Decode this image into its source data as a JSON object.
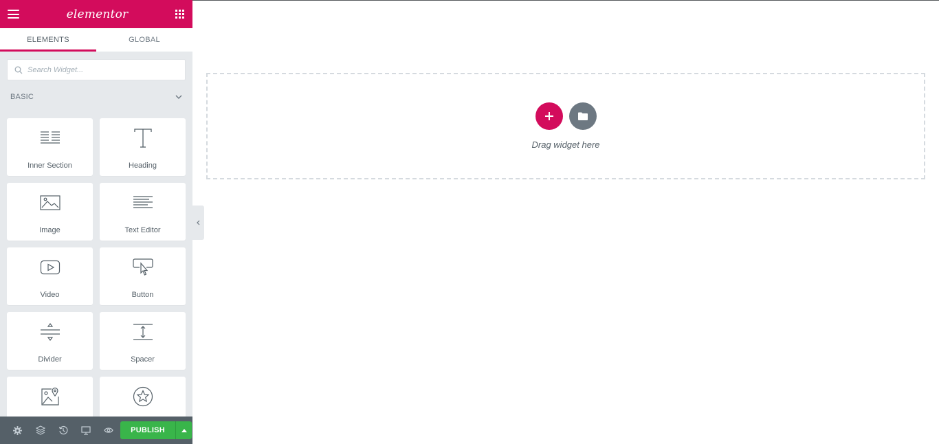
{
  "app": {
    "logo": "elementor",
    "brand_color": "#d30c5c"
  },
  "tabs": [
    {
      "label": "ELEMENTS",
      "active": true
    },
    {
      "label": "GLOBAL",
      "active": false
    }
  ],
  "search": {
    "placeholder": "Search Widget..."
  },
  "category": {
    "label": "BASIC",
    "expanded": true
  },
  "widgets": [
    {
      "label": "Inner Section",
      "icon": "columns-icon"
    },
    {
      "label": "Heading",
      "icon": "heading-icon"
    },
    {
      "label": "Image",
      "icon": "image-icon"
    },
    {
      "label": "Text Editor",
      "icon": "text-editor-icon"
    },
    {
      "label": "Video",
      "icon": "video-icon"
    },
    {
      "label": "Button",
      "icon": "button-icon"
    },
    {
      "label": "Divider",
      "icon": "divider-icon"
    },
    {
      "label": "Spacer",
      "icon": "spacer-icon"
    },
    {
      "label": "",
      "icon": "google-maps-icon"
    },
    {
      "label": "",
      "icon": "star-icon"
    }
  ],
  "footer": {
    "publish_label": "PUBLISH",
    "publish_color": "#39b54a"
  },
  "canvas": {
    "drop_text": "Drag widget here"
  }
}
